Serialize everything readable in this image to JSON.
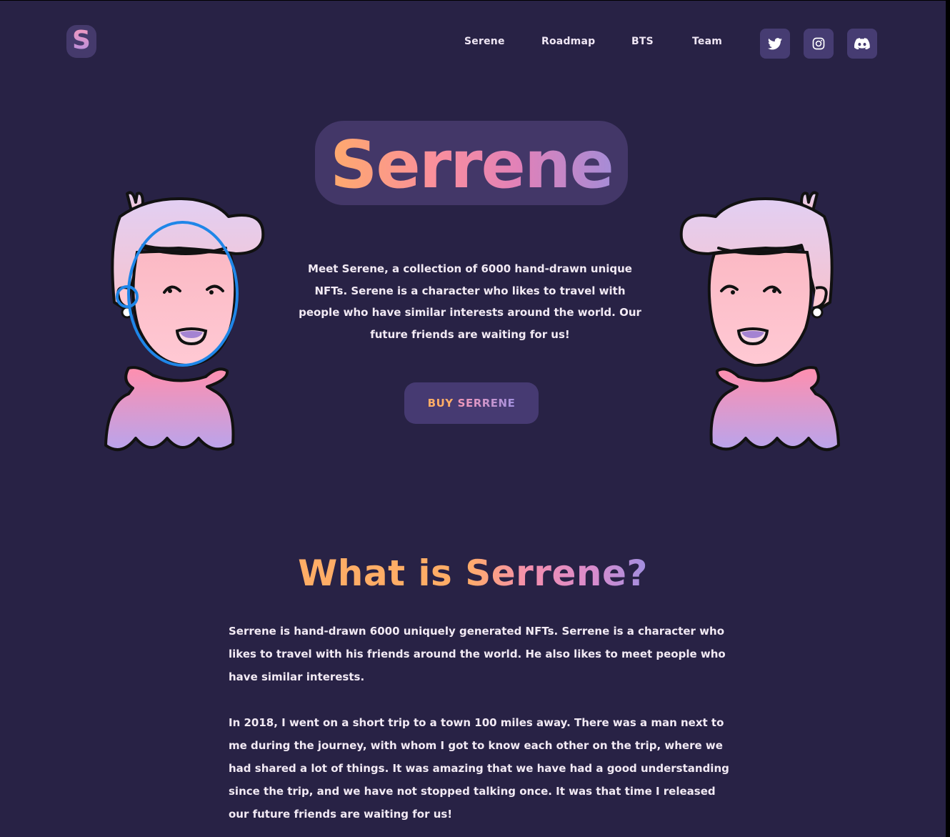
{
  "brand": {
    "logo_letter": "S"
  },
  "nav": {
    "items": [
      {
        "label": "Serene"
      },
      {
        "label": "Roadmap"
      },
      {
        "label": "BTS"
      },
      {
        "label": "Team"
      }
    ]
  },
  "social": {
    "twitter": "twitter-icon",
    "instagram": "instagram-icon",
    "discord": "discord-icon"
  },
  "hero": {
    "title": "Serrene",
    "description": "Meet Serene, a collection of 6000 hand-drawn unique NFTs. Serene is a character who likes to travel with people who have similar interests around the world. Our future friends are waiting for us!",
    "button_word1": "BUY",
    "button_word2": "SERRENE"
  },
  "about": {
    "title_part1": "What is ",
    "title_part2": "Serrene?",
    "paragraph1": "Serrene is hand-drawn 6000 uniquely generated NFTs. Serrene is a character who likes to travel with his friends around the world. He also likes to meet people who have similar interests.",
    "paragraph2": "In 2018, I went on a short trip to a town 100 miles away. There was a man next to me during the journey, with whom I got to know each other on the trip, where we had shared a lot of things. It was amazing that we have had a good understanding since the trip, and we have not stopped talking once. It was that time I released our future friends are waiting for us!"
  },
  "colors": {
    "background": "#282245",
    "accent_orange": "#ffad66",
    "accent_pink": "#f38fae",
    "accent_purple": "#a18fe0",
    "button_bg": "#463a72"
  }
}
